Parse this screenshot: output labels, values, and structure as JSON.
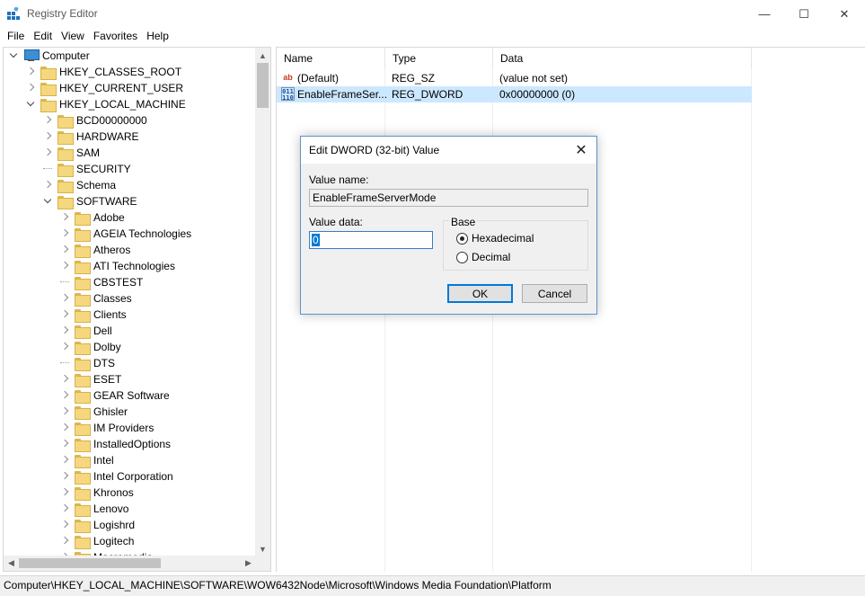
{
  "window": {
    "title": "Registry Editor",
    "controls": {
      "minimize": "—",
      "maximize": "☐",
      "close": "✕"
    }
  },
  "menu": [
    "File",
    "Edit",
    "View",
    "Favorites",
    "Help"
  ],
  "tree": {
    "root": "Computer",
    "items": [
      {
        "label": "HKEY_CLASSES_ROOT",
        "level": 1,
        "state": "collapsed"
      },
      {
        "label": "HKEY_CURRENT_USER",
        "level": 1,
        "state": "collapsed"
      },
      {
        "label": "HKEY_LOCAL_MACHINE",
        "level": 1,
        "state": "expanded"
      },
      {
        "label": "BCD00000000",
        "level": 2,
        "state": "collapsed"
      },
      {
        "label": "HARDWARE",
        "level": 2,
        "state": "collapsed"
      },
      {
        "label": "SAM",
        "level": 2,
        "state": "collapsed"
      },
      {
        "label": "SECURITY",
        "level": 2,
        "state": "none"
      },
      {
        "label": "Schema",
        "level": 2,
        "state": "collapsed"
      },
      {
        "label": "SOFTWARE",
        "level": 2,
        "state": "expanded"
      },
      {
        "label": "Adobe",
        "level": 3,
        "state": "collapsed"
      },
      {
        "label": "AGEIA Technologies",
        "level": 3,
        "state": "collapsed"
      },
      {
        "label": "Atheros",
        "level": 3,
        "state": "collapsed"
      },
      {
        "label": "ATI Technologies",
        "level": 3,
        "state": "collapsed"
      },
      {
        "label": "CBSTEST",
        "level": 3,
        "state": "none"
      },
      {
        "label": "Classes",
        "level": 3,
        "state": "collapsed"
      },
      {
        "label": "Clients",
        "level": 3,
        "state": "collapsed"
      },
      {
        "label": "Dell",
        "level": 3,
        "state": "collapsed"
      },
      {
        "label": "Dolby",
        "level": 3,
        "state": "collapsed"
      },
      {
        "label": "DTS",
        "level": 3,
        "state": "none"
      },
      {
        "label": "ESET",
        "level": 3,
        "state": "collapsed"
      },
      {
        "label": "GEAR Software",
        "level": 3,
        "state": "collapsed"
      },
      {
        "label": "Ghisler",
        "level": 3,
        "state": "collapsed"
      },
      {
        "label": "IM Providers",
        "level": 3,
        "state": "collapsed"
      },
      {
        "label": "InstalledOptions",
        "level": 3,
        "state": "collapsed"
      },
      {
        "label": "Intel",
        "level": 3,
        "state": "collapsed"
      },
      {
        "label": "Intel Corporation",
        "level": 3,
        "state": "collapsed"
      },
      {
        "label": "Khronos",
        "level": 3,
        "state": "collapsed"
      },
      {
        "label": "Lenovo",
        "level": 3,
        "state": "collapsed"
      },
      {
        "label": "Logishrd",
        "level": 3,
        "state": "collapsed"
      },
      {
        "label": "Logitech",
        "level": 3,
        "state": "collapsed"
      },
      {
        "label": "Macromedia",
        "level": 3,
        "state": "collapsed"
      }
    ]
  },
  "list": {
    "columns": [
      "Name",
      "Type",
      "Data"
    ],
    "rows": [
      {
        "name": "(Default)",
        "type": "REG_SZ",
        "data": "(value not set)",
        "icon": "string-value-icon",
        "selected": false
      },
      {
        "name": "EnableFrameSer...",
        "type": "REG_DWORD",
        "data": "0x00000000 (0)",
        "icon": "binary-value-icon",
        "selected": true
      }
    ]
  },
  "status": "Computer\\HKEY_LOCAL_MACHINE\\SOFTWARE\\WOW6432Node\\Microsoft\\Windows Media Foundation\\Platform",
  "dialog": {
    "title": "Edit DWORD (32-bit) Value",
    "value_name_label": "Value name:",
    "value_name": "EnableFrameServerMode",
    "value_data_label": "Value data:",
    "value_data": "0",
    "base_label": "Base",
    "base_options": [
      "Hexadecimal",
      "Decimal"
    ],
    "base_selected": "Hexadecimal",
    "ok_label": "OK",
    "cancel_label": "Cancel"
  }
}
